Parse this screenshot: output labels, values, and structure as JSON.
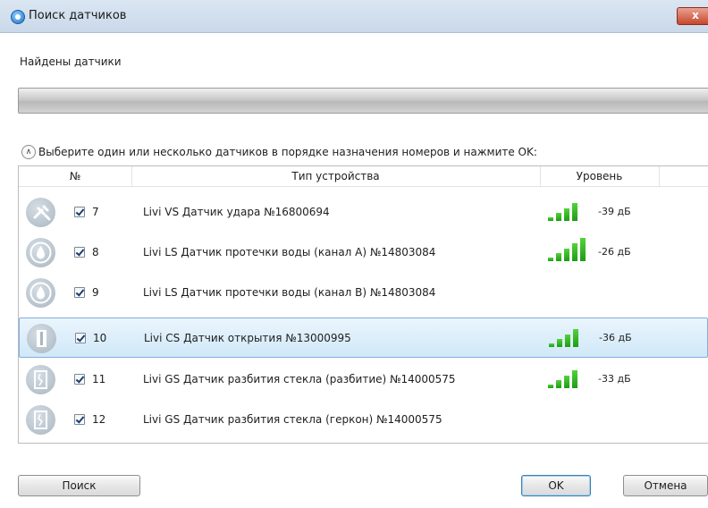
{
  "window": {
    "title": "Поиск датчиков",
    "close_symbol": "x"
  },
  "found_label": "Найдены датчики",
  "progress": {
    "fraction": 0
  },
  "instruction": "Выберите один или несколько датчиков в порядке назначения номеров и нажмите OK:",
  "table": {
    "headers": {
      "num": "№",
      "type": "Тип устройства",
      "level": "Уровень"
    },
    "rows": [
      {
        "icon": "shock-sensor-icon",
        "checked": true,
        "num": "7",
        "type": "Livi VS Датчик удара №16800694",
        "bars": 4,
        "level": "-39 дБ",
        "selected": false
      },
      {
        "icon": "water-leak-icon",
        "checked": true,
        "num": "8",
        "type": "Livi LS Датчик протечки воды (канал А) №14803084",
        "bars": 5,
        "level": "-26 дБ",
        "selected": false
      },
      {
        "icon": "water-leak-icon",
        "checked": true,
        "num": "9",
        "type": "Livi LS Датчик протечки воды (канал В) №14803084",
        "bars": 0,
        "level": "",
        "selected": false
      },
      {
        "icon": "door-open-icon",
        "checked": true,
        "num": "10",
        "type": "Livi CS Датчик открытия №13000995",
        "bars": 4,
        "level": "-36 дБ",
        "selected": true
      },
      {
        "icon": "glass-break-icon",
        "checked": true,
        "num": "11",
        "type": "Livi GS Датчик разбития стекла (разбитие) №14000575",
        "bars": 4,
        "level": "-33 дБ",
        "selected": false
      },
      {
        "icon": "glass-break-icon",
        "checked": true,
        "num": "12",
        "type": "Livi GS Датчик разбития стекла (геркон) №14000575",
        "bars": 0,
        "level": "",
        "selected": false
      }
    ]
  },
  "buttons": {
    "search": "Поиск",
    "ok": "OK",
    "cancel": "Отмена"
  }
}
